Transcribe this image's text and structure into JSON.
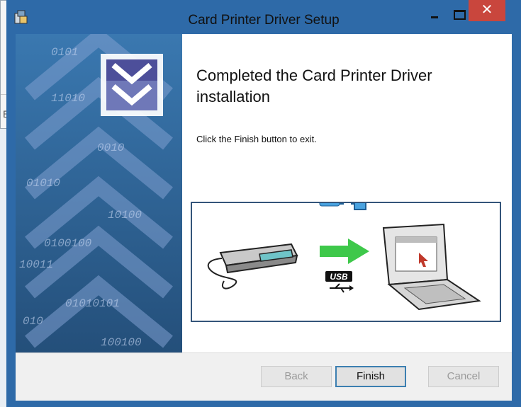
{
  "window": {
    "title": "Card Printer Driver Setup",
    "close_glyph": "✕"
  },
  "background_window": {
    "partial_char": "E"
  },
  "content": {
    "heading": "Completed the Card Printer Driver installation",
    "subtext": "Click the Finish button to exit.",
    "usb_label": "USB"
  },
  "footer": {
    "back_label": "Back",
    "finish_label": "Finish",
    "cancel_label": "Cancel"
  },
  "banner": {
    "binary_text": [
      "0101",
      "11010",
      "0010",
      "01010",
      "10100",
      "0100100",
      "10011",
      "01010101",
      "010",
      "100100"
    ]
  },
  "colors": {
    "titlebar": "#2e6aa8",
    "close_button": "#c9463d",
    "banner": "#2a5f8f",
    "usb_arrow": "#3ec84a"
  },
  "icons": [
    "installer-app-icon",
    "minimize-icon",
    "maximize-icon",
    "close-icon",
    "chevron-down-logo",
    "usb-icon",
    "card-printer-icon",
    "laptop-icon",
    "usb-connector-icon"
  ]
}
